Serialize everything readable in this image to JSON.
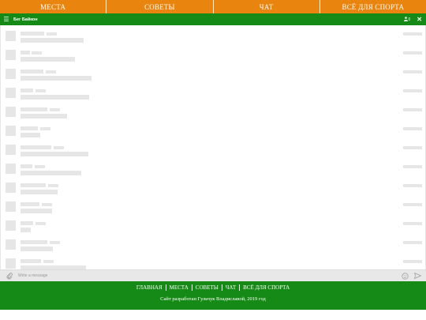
{
  "topnav": {
    "items": [
      {
        "label": "МЕСТА"
      },
      {
        "label": "СОВЕТЫ"
      },
      {
        "label": "ЧАТ"
      },
      {
        "label": "ВСЁ ДЛЯ СПОРТА"
      }
    ]
  },
  "chat": {
    "title": "Бег Байкон",
    "users_count": "0",
    "menu_icon": "menu-icon",
    "user_icon": "user-icon",
    "close_icon": "close-icon"
  },
  "composer": {
    "placeholder": "Write a message",
    "attach_icon": "paperclip-icon",
    "emoji_icon": "smiley-icon",
    "send_icon": "send-icon"
  },
  "footer": {
    "links": [
      {
        "label": "ГЛАВНАЯ"
      },
      {
        "label": "МЕСТА"
      },
      {
        "label": "СОВЕТЫ"
      },
      {
        "label": "ЧАТ"
      },
      {
        "label": "ВСЁ ДЛЯ СПОРТА"
      }
    ],
    "credit": "Сайт разработан Гульчук Владиславой, 2019 год"
  },
  "colors": {
    "nav_orange": "#e9840f",
    "header_green": "#168a16",
    "placeholder_gray": "#e6e6e6"
  }
}
